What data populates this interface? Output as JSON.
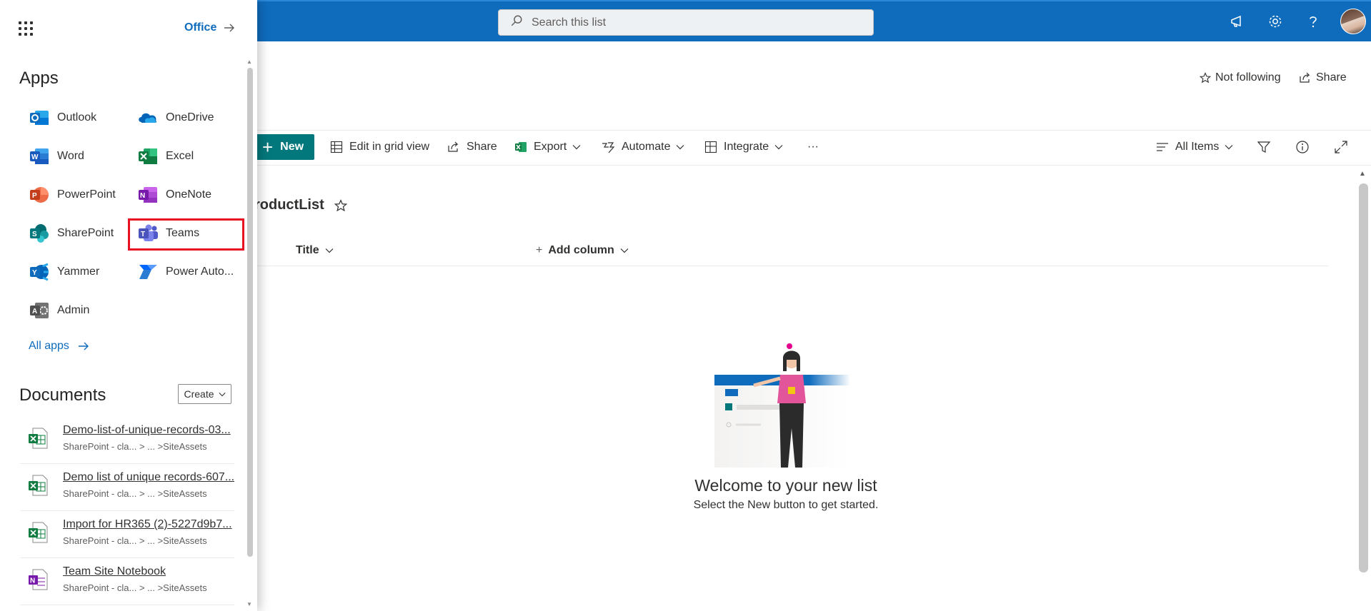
{
  "topbar": {
    "search_placeholder": "Search this list"
  },
  "page": {
    "follow_label": "Not following",
    "share_label": "Share",
    "list_title": "roductList"
  },
  "commands": {
    "new_label": "New",
    "edit_grid_label": "Edit in grid view",
    "share_label": "Share",
    "export_label": "Export",
    "automate_label": "Automate",
    "integrate_label": "Integrate",
    "more_label": "···",
    "view_label": "All Items"
  },
  "columns": {
    "title_label": "Title",
    "add_column_label": "Add column"
  },
  "empty_state": {
    "heading": "Welcome to your new list",
    "subtext": "Select the New button to get started."
  },
  "launcher": {
    "office_label": "Office",
    "apps_title": "Apps",
    "apps": [
      {
        "label": "Outlook",
        "icon": "outlook-icon",
        "color": "#0f6cbd"
      },
      {
        "label": "OneDrive",
        "icon": "onedrive-icon",
        "color": "#0364b8"
      },
      {
        "label": "Word",
        "icon": "word-icon",
        "color": "#185abd"
      },
      {
        "label": "Excel",
        "icon": "excel-icon",
        "color": "#107c41"
      },
      {
        "label": "PowerPoint",
        "icon": "powerpoint-icon",
        "color": "#c43e1c"
      },
      {
        "label": "OneNote",
        "icon": "onenote-icon",
        "color": "#7719aa"
      },
      {
        "label": "SharePoint",
        "icon": "sharepoint-icon",
        "color": "#036c70"
      },
      {
        "label": "Teams",
        "icon": "teams-icon",
        "color": "#5059c9"
      },
      {
        "label": "Yammer",
        "icon": "yammer-icon",
        "color": "#0364b8"
      },
      {
        "label": "Power Auto...",
        "icon": "power-automate-icon",
        "color": "#0066ff"
      },
      {
        "label": "Admin",
        "icon": "admin-icon",
        "color": "#505050"
      }
    ],
    "all_apps_label": "All apps",
    "documents_title": "Documents",
    "create_label": "Create",
    "documents": [
      {
        "name": "Demo-list-of-unique-records-03...",
        "path": "SharePoint - cla... > ... >SiteAssets",
        "icon": "excel-file-icon"
      },
      {
        "name": "Demo list of unique records-607...",
        "path": "SharePoint - cla... > ... >SiteAssets",
        "icon": "excel-file-icon"
      },
      {
        "name": "Import for HR365 (2)-5227d9b7...",
        "path": "SharePoint - cla... > ... >SiteAssets",
        "icon": "excel-file-icon"
      },
      {
        "name": "Team Site Notebook",
        "path": "SharePoint - cla... > ... >SiteAssets",
        "icon": "onenote-file-icon"
      }
    ]
  },
  "colors": {
    "suite_bar": "#0f6cbd",
    "new_button": "#03787c",
    "highlight_box": "#e81123",
    "link": "#0f6cbd"
  }
}
